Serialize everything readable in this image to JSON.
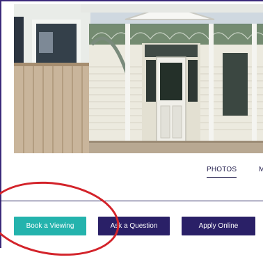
{
  "tabs": {
    "photos": "PHOTOS",
    "next": "M"
  },
  "buttons": {
    "book": "Book a Viewing",
    "ask": "Ask a Question",
    "apply": "Apply Online"
  },
  "colors": {
    "accent_teal": "#24b3ad",
    "primary_navy": "#2a2067",
    "annotation_red": "#d3232a"
  }
}
